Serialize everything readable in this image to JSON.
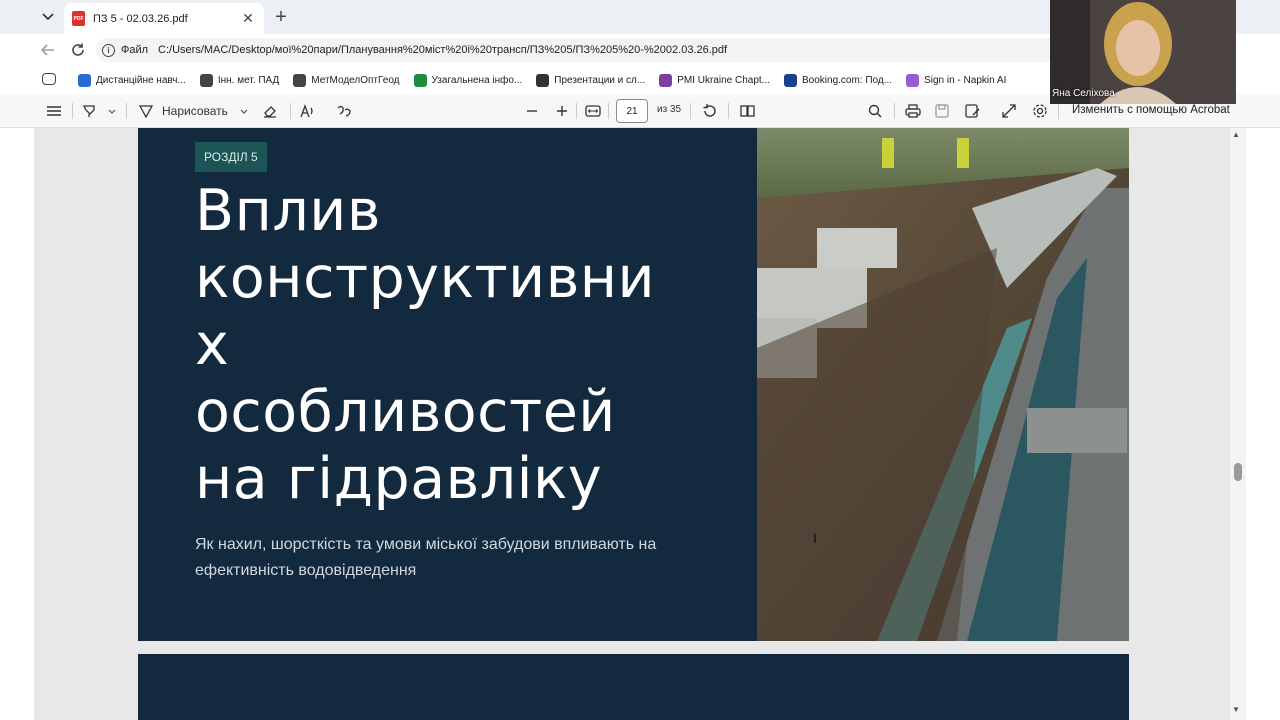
{
  "browser": {
    "tab": {
      "title": "ПЗ 5 - 02.03.26.pdf",
      "pdf_label": "PDF",
      "close": "✕"
    },
    "new_tab": "+",
    "address": {
      "scheme": "Файл",
      "url": "C:/Users/MAC/Desktop/мої%20пари/Планування%20міст%20і%20трансп/ПЗ%205/ПЗ%205%20-%2002.03.26.pdf"
    },
    "bookmarks": [
      {
        "label": "Дистанційне навч...",
        "color": "#2b6cd4"
      },
      {
        "label": "Інн. мет. ПАД",
        "color": "#444"
      },
      {
        "label": "МетМоделОптГеод",
        "color": "#444"
      },
      {
        "label": "Узагальнена інфо...",
        "color": "#1e8e3e"
      },
      {
        "label": "Презентации и сл...",
        "color": "#333"
      },
      {
        "label": "PMI Ukraine Chapt...",
        "color": "#7b3fa0"
      },
      {
        "label": "Booking.com: Под...",
        "color": "#1d3f8f"
      },
      {
        "label": "Sign in - Napkin AI",
        "color": "#9c5bd6"
      }
    ]
  },
  "pdf_toolbar": {
    "draw_label": "Нарисовать",
    "page_current": "21",
    "page_total": "из 35",
    "acrobat_label": "Изменить с помощью Acrobat"
  },
  "slide": {
    "section_label": "РОЗДІЛ 5",
    "heading_lines": [
      "Вплив",
      "конструктивни",
      "х",
      "особливостей",
      "на гідравліку"
    ],
    "subtitle": "Як нахил, шорсткість та умови міської забудови впливають на ефективність водовідведення"
  },
  "webcam": {
    "name": "Яна Селіхова"
  },
  "colors": {
    "slide_bg": "#132a3e",
    "badge_bg": "#1d5456",
    "accent_tab": "#ffffff"
  }
}
